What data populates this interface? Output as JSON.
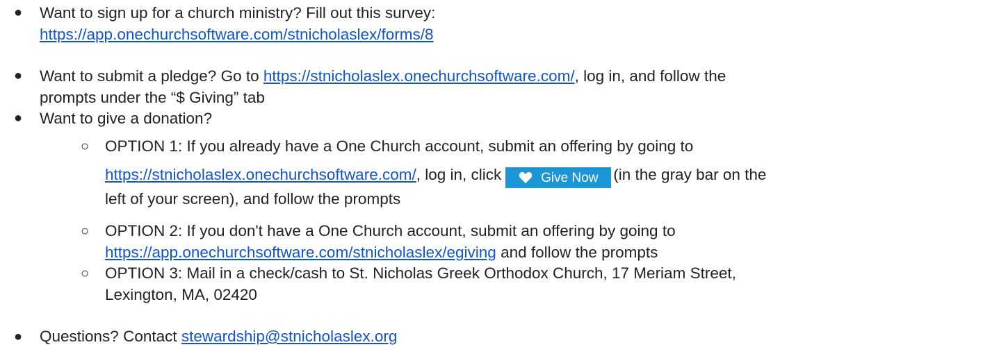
{
  "colors": {
    "link": "#1155cc",
    "text": "#222222",
    "give_button": "#1a95d6"
  },
  "items": [
    {
      "text1": "Want to sign up for a church ministry? Fill out this survey:",
      "link": "https://app.onechurchsoftware.com/stnicholaslex/forms/8"
    },
    {
      "text1": "Want to submit a pledge? Go to ",
      "link": "https://stnicholaslex.onechurchsoftware.com/",
      "text2": ", log in, and follow the",
      "text3": "prompts under the “$ Giving” tab"
    },
    {
      "text1": "Want to give a donation?",
      "options": [
        {
          "text1": "OPTION 1: If you already have a One Church account, submit an offering by going to",
          "link": "https://stnicholaslex.onechurchsoftware.com/",
          "text2": ", log in, click",
          "button_label": "Give Now",
          "button_icon": "heart-icon",
          "text3": "(in the gray bar on the",
          "text4": "left of your screen), and follow the prompts"
        },
        {
          "text1": "OPTION 2: If you don't have a One Church account, submit an offering by going to",
          "link": "https://app.onechurchsoftware.com/stnicholaslex/egiving",
          "text2": " and follow the prompts"
        },
        {
          "text1": "OPTION 3: Mail in a check/cash to St. Nicholas Greek Orthodox Church, 17 Meriam Street,",
          "text2": "Lexington, MA, 02420"
        }
      ]
    },
    {
      "text1": "Questions? Contact ",
      "link": "stewardship@stnicholaslex.org"
    }
  ]
}
